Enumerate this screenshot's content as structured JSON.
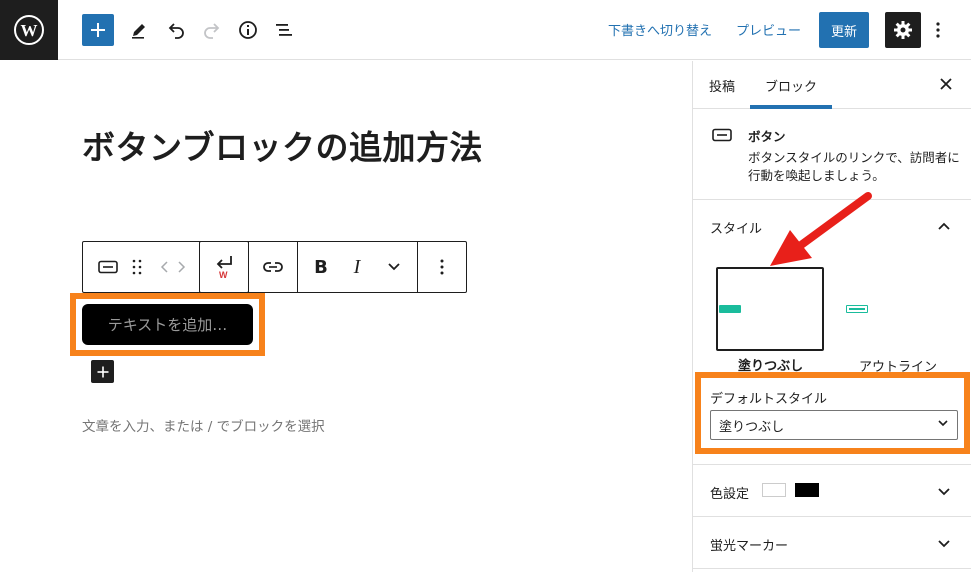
{
  "topbar": {
    "switch_to_draft": "下書きへ切り替え",
    "preview": "プレビュー",
    "update": "更新",
    "icons": [
      "wordpress-logo",
      "plus",
      "pencil",
      "undo",
      "redo",
      "info",
      "list-view",
      "gear",
      "more-vertical"
    ]
  },
  "editor": {
    "post_title": "ボタンブロックの追加方法",
    "button_placeholder": "テキストを追加…",
    "paragraph_placeholder": "文章を入力、または / でブロックを選択",
    "toolbar": {
      "bold": "B",
      "italic": "I",
      "icons": [
        "button-block",
        "drag-handle",
        "move-arrows",
        "enter-link",
        "link",
        "bold",
        "italic",
        "chevron-down",
        "more-vertical"
      ]
    }
  },
  "sidebar": {
    "tabs": [
      "投稿",
      "ブロック"
    ],
    "active_tab": "ブロック",
    "block_card": {
      "title": "ボタン",
      "description": "ボタンスタイルのリンクで、訪問者に行動を喚起しましょう。"
    },
    "styles": {
      "label": "スタイル",
      "options": [
        "塗りつぶし",
        "アウトライン"
      ],
      "selected": "塗りつぶし"
    },
    "default_style": {
      "label": "デフォルトスタイル",
      "value": "塗りつぶし"
    },
    "color_settings": {
      "label": "色設定",
      "swatches": [
        "#ffffff",
        "#000000"
      ]
    },
    "highlighter": {
      "label": "蛍光マーカー"
    }
  },
  "colors": {
    "accent": "#2271b1",
    "highlight": "#f7821b",
    "arrow": "#e8201a",
    "mini_button": "#1abc9c"
  }
}
